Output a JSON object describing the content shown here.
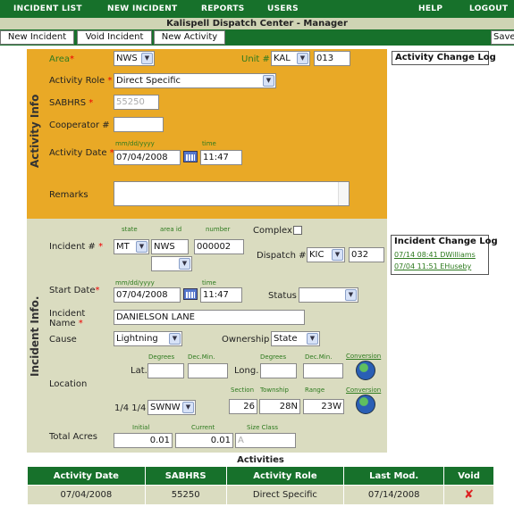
{
  "nav": {
    "items": [
      "INCIDENT LIST",
      "NEW INCIDENT",
      "REPORTS",
      "USERS",
      "HELP",
      "LOGOUT"
    ]
  },
  "title": "Kalispell Dispatch Center - Manager",
  "toolbar": {
    "new_incident": "New Incident",
    "void_incident": "Void Incident",
    "new_activity": "New Activity",
    "save": "Save"
  },
  "activity": {
    "section_label": "Activity Info",
    "area_label": "Area",
    "area_value": "NWS",
    "unit_label": "Unit #",
    "unit_prefix": "KAL",
    "unit_number": "013",
    "role_label": "Activity Role",
    "role_value": "Direct Specific",
    "sabhrs_label": "SABHRS",
    "sabhrs_value": "55250",
    "cooperator_label": "Cooperator #",
    "cooperator_value": "",
    "date_hint": "mm/dd/yyyy",
    "time_hint": "time",
    "date_label": "Activity Date",
    "date_value": "07/04/2008",
    "time_value": "11:47",
    "remarks_label": "Remarks"
  },
  "activity_log": {
    "title": "Activity Change Log"
  },
  "incident": {
    "section_label": "Incident Info.",
    "number_label": "Incident #",
    "hint_state": "state",
    "hint_area": "area id",
    "hint_number": "number",
    "state_value": "MT",
    "area_id_value": "NWS",
    "number_value": "000002",
    "complex_label": "Complex",
    "dispatch_label": "Dispatch #",
    "dispatch_prefix": "KIC",
    "dispatch_number": "032",
    "date_hint": "mm/dd/yyyy",
    "time_hint": "time",
    "start_label": "Start Date",
    "start_date": "07/04/2008",
    "start_time": "11:47",
    "status_label": "Status",
    "status_value": "",
    "name_label_1": "Incident",
    "name_label_2": "Name",
    "name_value": "DANIELSON LANE",
    "cause_label": "Cause",
    "cause_value": "Lightning",
    "ownership_label": "Ownership",
    "ownership_value": "State",
    "location_label": "Location",
    "hint_degrees": "Degrees",
    "hint_decmin": "Dec.Min.",
    "lat_label": "Lat.",
    "long_label": "Long.",
    "conversion_label": "Conversion",
    "quarter_label": "1/4 1/4",
    "quarter_value": "SWNW",
    "hint_section": "Section",
    "hint_township": "Township",
    "hint_range": "Range",
    "section_value": "26",
    "township_value": "28N",
    "range_value": "23W",
    "acres_label": "Total Acres",
    "hint_initial": "Initial",
    "hint_current": "Current",
    "hint_size": "Size Class",
    "initial_value": "0.01",
    "current_value": "0.01",
    "size_class_value": "A"
  },
  "incident_log": {
    "title": "Incident Change Log",
    "entries": [
      "07/14 08:41 DWilliams",
      "07/04 11:51 EHuseby"
    ]
  },
  "activities": {
    "title": "Activities",
    "headers": [
      "Activity Date",
      "SABHRS",
      "Activity Role",
      "Last Mod.",
      "Void"
    ],
    "rows": [
      [
        "07/04/2008",
        "55250",
        "Direct Specific",
        "07/14/2008"
      ]
    ]
  }
}
